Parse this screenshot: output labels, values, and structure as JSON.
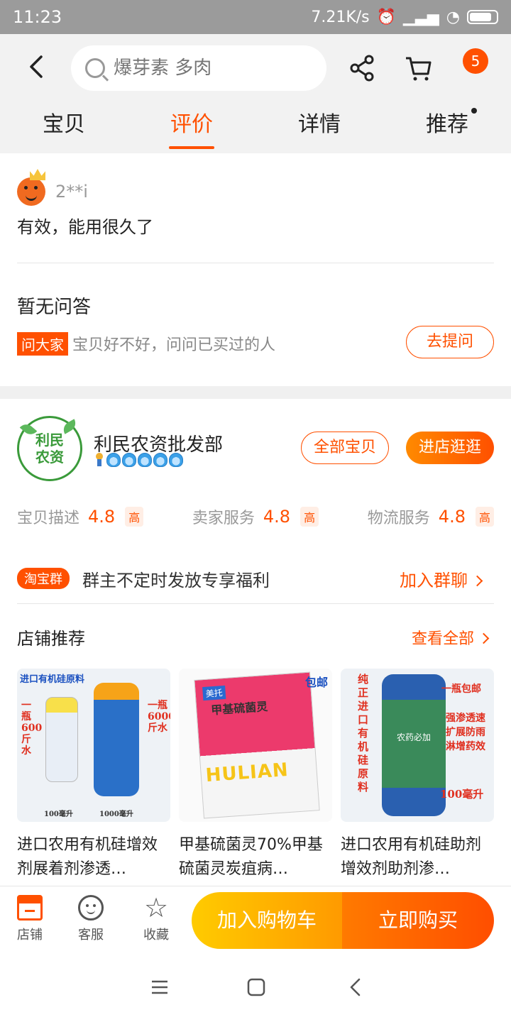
{
  "status_bar": {
    "time": "11:23",
    "net_speed": "7.21K/s"
  },
  "header": {
    "search_placeholder": "爆芽素 多肉",
    "cart_badge": "5",
    "tabs": [
      {
        "label": "宝贝",
        "active": false
      },
      {
        "label": "评价",
        "active": true
      },
      {
        "label": "详情",
        "active": false
      },
      {
        "label": "推荐",
        "active": false
      }
    ]
  },
  "review": {
    "username": "2**i",
    "text": "有效，能用很久了"
  },
  "qa": {
    "title": "暂无问答",
    "tag": "问大家",
    "hint": "宝贝好不好，问问已买过的人",
    "ask_label": "去提问"
  },
  "shop": {
    "logo_text_line1": "利民",
    "logo_text_line2": "农资",
    "name": "利民农资批发部",
    "all_items_label": "全部宝贝",
    "visit_label": "进店逛逛",
    "scores": [
      {
        "label": "宝贝描述",
        "value": "4.8",
        "level": "高"
      },
      {
        "label": "卖家服务",
        "value": "4.8",
        "level": "高"
      },
      {
        "label": "物流服务",
        "value": "4.8",
        "level": "高"
      }
    ],
    "group": {
      "tag": "淘宝群",
      "text": "群主不定时发放专享福利",
      "join_label": "加入群聊"
    },
    "recommend": {
      "title": "店铺推荐",
      "see_all": "查看全部",
      "products": [
        {
          "title": "进口农用有机硅增效剂展着剂渗透…",
          "img_top": "进口有机硅原料",
          "img_left": "一瓶600斤水",
          "img_right": "一瓶6000斤水",
          "img_cap1": "100毫升",
          "img_cap2": "1000毫升"
        },
        {
          "title": "甲基硫菌灵70%甲基硫菌灵炭疽病…",
          "img_corner": "包邮",
          "img_brand": "美托",
          "img_name": "甲基硫菌灵",
          "img_big": "HULIAN"
        },
        {
          "title": "进口农用有机硅助剂增效剂助剂渗…",
          "img_left": "纯正进口有机硅原料",
          "img_corner": "一瓶包邮",
          "img_right": "强渗透速扩展防雨淋增药效",
          "img_bottom": "100毫升",
          "img_label": "农药必加"
        }
      ]
    }
  },
  "bottom_bar": {
    "store_label": "店铺",
    "service_label": "客服",
    "favorite_label": "收藏",
    "cart_label": "加入购物车",
    "buy_label": "立即购买"
  }
}
